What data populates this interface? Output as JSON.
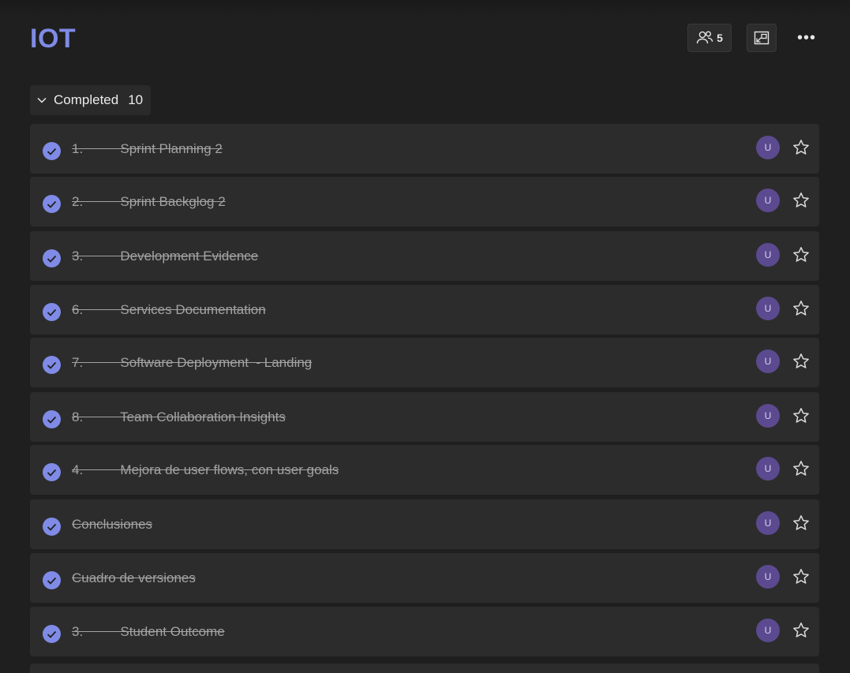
{
  "header": {
    "title": "IOT",
    "members_count": "5",
    "members_icon": "people-icon",
    "share_icon": "share-screen-icon",
    "more_label": "•••"
  },
  "group": {
    "label": "Completed",
    "count": "10"
  },
  "colors": {
    "accent": "#7f8be6",
    "avatar": "#5b4a8f",
    "row": "#2c2c2c",
    "background": "#1f1f1f"
  },
  "tasks": [
    {
      "title": "1.          Sprint Planning 2",
      "avatar": "U"
    },
    {
      "title": "2.          Sprint Backglog 2",
      "avatar": "U"
    },
    {
      "title": "3.          Development Evidence",
      "avatar": "U"
    },
    {
      "title": "6.          Services Documentation",
      "avatar": "U"
    },
    {
      "title": "7.          Software Deployment  - Landing",
      "avatar": "U"
    },
    {
      "title": "8.          Team Collaboration Insights",
      "avatar": "U"
    },
    {
      "title": "4.          Mejora de user flows, con user goals",
      "avatar": "U"
    },
    {
      "title": "Conclusiones",
      "avatar": "U"
    },
    {
      "title": "Cuadro de versiones",
      "avatar": "U"
    },
    {
      "title": "3.          Student Outcome",
      "avatar": "U"
    }
  ]
}
